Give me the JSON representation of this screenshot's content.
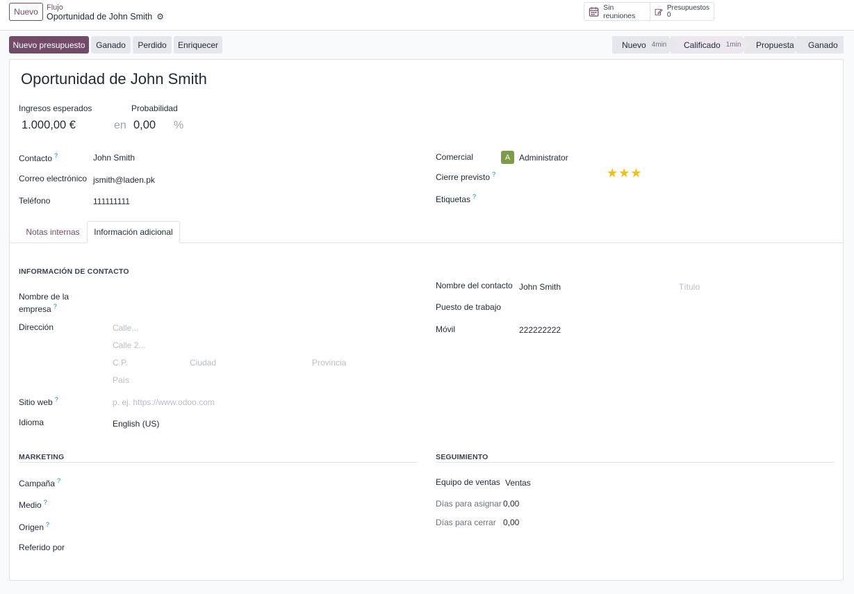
{
  "header": {
    "new_button": "Nuevo",
    "breadcrumb_parent": "Flujo",
    "breadcrumb_current": "Oportunidad de John Smith",
    "meetings_label": "Sin reuniones",
    "quotes_label": "Presupuestos",
    "quotes_count": "0"
  },
  "actions": {
    "new_quote": "Nuevo presupuesto",
    "won": "Ganado",
    "lost": "Perdido",
    "enrich": "Enriquecer"
  },
  "stages": [
    {
      "label": "Nuevo",
      "time": "4min"
    },
    {
      "label": "Calificado",
      "time": "1min"
    },
    {
      "label": "Propuesta",
      "time": ""
    },
    {
      "label": "Ganado",
      "time": ""
    }
  ],
  "form": {
    "title": "Oportunidad de John Smith",
    "expected_revenue_label": "Ingresos esperados",
    "expected_revenue": "1.000,00 €",
    "probability_label": "Probabilidad",
    "at_label": "en",
    "probability": "0,00",
    "percent": "%",
    "contact_label": "Contacto",
    "contact": "John Smith",
    "email_label": "Correo electrónico",
    "email": "jsmith@laden.pk",
    "phone_label": "Teléfono",
    "phone": "111111111",
    "salesperson_label": "Comercial",
    "salesperson_initial": "A",
    "salesperson": "Administrator",
    "expected_closing_label": "Cierre previsto",
    "priority_stars": 3,
    "tags_label": "Etiquetas",
    "help_mark": "?"
  },
  "tabs": {
    "internal_notes": "Notas internas",
    "extra_info": "Información adicional"
  },
  "contact_info": {
    "section": "INFORMACIÓN DE CONTACTO",
    "company_label_1": "Nombre de la",
    "company_label_2": "empresa",
    "address_label": "Dirección",
    "street_ph": "Calle...",
    "street2_ph": "Calle 2...",
    "zip_ph": "C.P.",
    "city_ph": "Ciudad",
    "state_ph": "Provincia",
    "country_ph": "País",
    "website_label": "Sitio web",
    "website_ph": "p. ej. https://www.odoo.com",
    "language_label": "Idioma",
    "language": "English (US)",
    "contact_name_label": "Nombre del contacto",
    "contact_name": "John Smith",
    "title_ph": "Título",
    "job_label": "Puesto de trabajo",
    "mobile_label": "Móvil",
    "mobile": "222222222"
  },
  "marketing": {
    "section": "MARKETING",
    "campaign_label": "Campaña",
    "medium_label": "Medio",
    "source_label": "Origen",
    "referred_label": "Referido por"
  },
  "tracking": {
    "section": "SEGUIMIENTO",
    "team_label": "Equipo de ventas",
    "team": "Ventas",
    "days_assign_label": "Días para asignar",
    "days_assign": "0,00",
    "days_close_label": "Días para cerrar",
    "days_close": "0,00"
  },
  "colors": {
    "brand": "#714b67",
    "star": "#f2c00f",
    "avatar": "#7c9c47"
  }
}
